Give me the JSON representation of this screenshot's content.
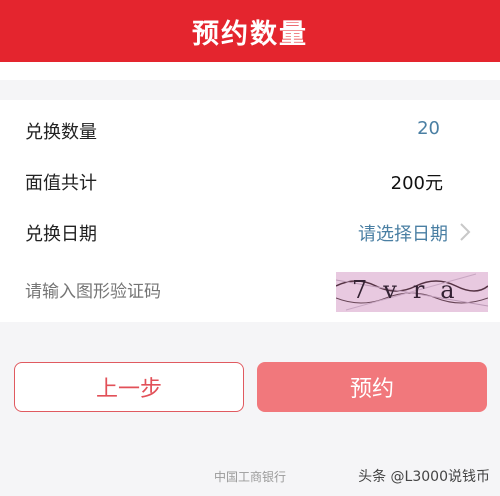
{
  "header": {
    "title": "预约数量"
  },
  "form": {
    "rows": [
      {
        "label": "兑换数量",
        "value": "20"
      },
      {
        "label": "面值共计",
        "value": "200元"
      },
      {
        "label": "兑换日期",
        "value": "请选择日期"
      }
    ],
    "captcha": {
      "placeholder": "请输入图形验证码",
      "image_text": "7vra"
    }
  },
  "buttons": {
    "prev_label": "上一步",
    "book_label": "预约"
  },
  "footer": {
    "bank": "中国工商银行",
    "watermark": "头条 @L3000说钱币"
  },
  "colors": {
    "brand_red": "#e4252e",
    "accent_blue": "#4a7fa3",
    "button_pink": "#f1787c"
  },
  "icons": {
    "date_chevron": "chevron-right-icon"
  }
}
